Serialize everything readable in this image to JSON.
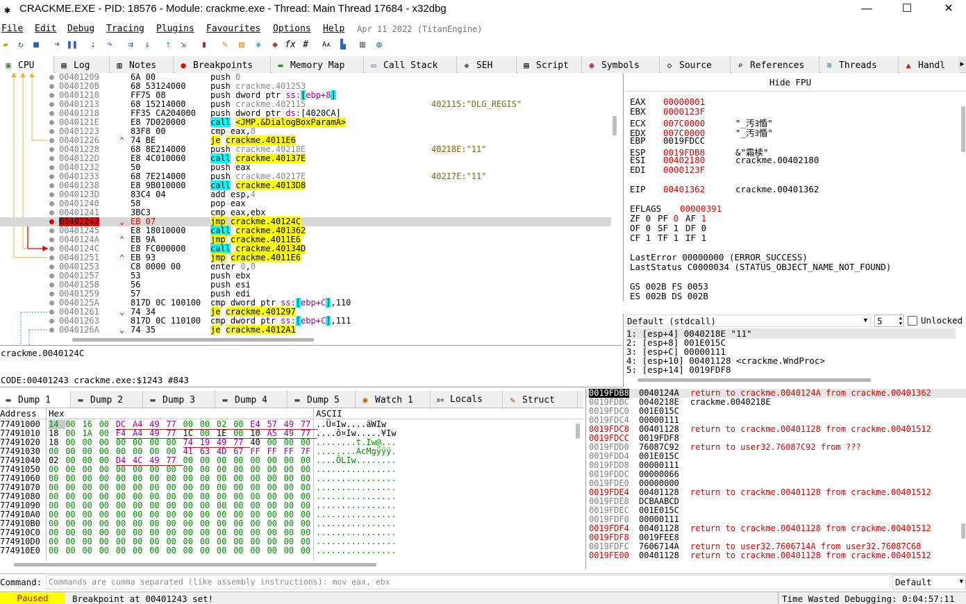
{
  "window": {
    "title": "CRACKME.EXE - PID: 18576 - Module: crackme.exe - Thread: Main Thread 17684 - x32dbg",
    "minimize": "—",
    "maximize": "☐",
    "close": "✕"
  },
  "menu": {
    "items": [
      "File",
      "Edit",
      "Debug",
      "Tracing",
      "Plugins",
      "Favourites",
      "Options",
      "Help"
    ],
    "date": "Apr 11 2022 (TitanEngine)"
  },
  "top_tabs": [
    {
      "label": "CPU",
      "icon": "cpu-icon",
      "glyph": "▣"
    },
    {
      "label": "Log",
      "icon": "log-icon",
      "glyph": "▤"
    },
    {
      "label": "Notes",
      "icon": "notes-icon",
      "glyph": "▥"
    },
    {
      "label": "Breakpoints",
      "icon": "breakpoint-icon",
      "glyph": "●"
    },
    {
      "label": "Memory Map",
      "icon": "memory-map-icon",
      "glyph": "▬"
    },
    {
      "label": "Call Stack",
      "icon": "call-stack-icon",
      "glyph": "▭"
    },
    {
      "label": "SEH",
      "icon": "seh-icon",
      "glyph": "◆"
    },
    {
      "label": "Script",
      "icon": "script-icon",
      "glyph": "▤"
    },
    {
      "label": "Symbols",
      "icon": "symbols-icon",
      "glyph": "◉"
    },
    {
      "label": "Source",
      "icon": "source-icon",
      "glyph": "◇"
    },
    {
      "label": "References",
      "icon": "references-icon",
      "glyph": "⌕"
    },
    {
      "label": "Threads",
      "icon": "threads-icon",
      "glyph": "≋"
    },
    {
      "label": "Handl",
      "icon": "handles-icon",
      "glyph": "▲"
    }
  ],
  "disasm": [
    {
      "addr": "00401209",
      "bytes": "6A 00",
      "ins": [
        [
          "push ",
          ""
        ],
        [
          "0",
          "c-gray"
        ]
      ],
      "comment": ""
    },
    {
      "addr": "0040120B",
      "bytes": "68 53124000",
      "bu": "53124000",
      "ins": [
        [
          "push ",
          ""
        ],
        [
          "crackme.401253",
          "c-gray"
        ]
      ],
      "comment": ""
    },
    {
      "addr": "00401210",
      "bytes": "FF75 08",
      "ins": [
        [
          "push dword ptr ",
          ""
        ],
        [
          "ss:",
          "c-mag"
        ],
        [
          "[",
          "hl-c"
        ],
        [
          "ebp+8",
          "c-mag"
        ],
        [
          "]",
          "hl-c"
        ]
      ],
      "comment": ""
    },
    {
      "addr": "00401213",
      "bytes": "68 15214000",
      "bu": "15214000",
      "ins": [
        [
          "push ",
          ""
        ],
        [
          "crackme.402115",
          "c-gray"
        ]
      ],
      "comment": "402115:\"DLG_REGIS\""
    },
    {
      "addr": "00401218",
      "bytes": "FF35 CA204000",
      "bu": "CA204000",
      "ins": [
        [
          "push dword ptr ",
          ""
        ],
        [
          "ds:",
          "c-mag"
        ],
        [
          "[4020CA]",
          ""
        ]
      ],
      "comment": ""
    },
    {
      "addr": "0040121E",
      "bytes": "E8 7D020000",
      "ins": [
        [
          "call",
          "hl-c"
        ],
        [
          " ",
          ""
        ],
        [
          "<JMP.&DialogBoxParamA>",
          "hl-y"
        ]
      ],
      "comment": ""
    },
    {
      "addr": "00401223",
      "bytes": "83F8 00",
      "ins": [
        [
          "cmp eax,",
          ""
        ],
        [
          "0",
          "c-gray"
        ]
      ],
      "comment": ""
    },
    {
      "addr": "00401226",
      "bytes": "74 BE",
      "mk": "^",
      "ins": [
        [
          "je",
          "hl-y"
        ],
        [
          " ",
          ""
        ],
        [
          "crackme.4011E6",
          "hl-y"
        ]
      ],
      "comment": ""
    },
    {
      "addr": "00401228",
      "bytes": "68 8E214000",
      "bu": "8E214000",
      "ins": [
        [
          "push ",
          ""
        ],
        [
          "crackme.40218E",
          "c-gray"
        ]
      ],
      "comment": "40218E:\"11\""
    },
    {
      "addr": "0040122D",
      "bytes": "E8 4C010000",
      "ins": [
        [
          "call",
          "hl-c"
        ],
        [
          " ",
          ""
        ],
        [
          "crackme.40137E",
          "hl-y"
        ]
      ],
      "comment": ""
    },
    {
      "addr": "00401232",
      "bytes": "50",
      "ins": [
        [
          "push eax",
          ""
        ]
      ],
      "comment": ""
    },
    {
      "addr": "00401233",
      "bytes": "68 7E214000",
      "bu": "7E214000",
      "ins": [
        [
          "push ",
          ""
        ],
        [
          "crackme.40217E",
          "c-gray"
        ]
      ],
      "comment": "40217E:\"11\""
    },
    {
      "addr": "00401238",
      "bytes": "E8 9B010000",
      "ins": [
        [
          "call",
          "hl-c"
        ],
        [
          " ",
          ""
        ],
        [
          "crackme.4013D8",
          "hl-y"
        ]
      ],
      "comment": ""
    },
    {
      "addr": "0040123D",
      "bytes": "83C4 04",
      "ins": [
        [
          "add esp,",
          ""
        ],
        [
          "4",
          "c-gray"
        ]
      ],
      "comment": ""
    },
    {
      "addr": "00401240",
      "bytes": "58",
      "ins": [
        [
          "pop eax",
          ""
        ]
      ],
      "comment": ""
    },
    {
      "addr": "00401241",
      "bytes": "3BC3",
      "ins": [
        [
          "cmp eax,ebx",
          ""
        ]
      ],
      "comment": ""
    },
    {
      "addr": "00401243",
      "bytes": "EB 07",
      "mk": "v",
      "sel": true,
      "bp": true,
      "ins": [
        [
          "jmp",
          "hl-y"
        ],
        [
          " ",
          ""
        ],
        [
          "crackme.40124C",
          "hl-y"
        ]
      ],
      "comment": ""
    },
    {
      "addr": "00401245",
      "bytes": "E8 18010000",
      "ins": [
        [
          "call",
          "hl-c"
        ],
        [
          " ",
          ""
        ],
        [
          "crackme.401362",
          "hl-y"
        ]
      ],
      "comment": ""
    },
    {
      "addr": "0040124A",
      "bytes": "EB 9A",
      "mk": "^",
      "ins": [
        [
          "jmp",
          "hl-y"
        ],
        [
          " ",
          ""
        ],
        [
          "crackme.4011E6",
          "hl-y"
        ]
      ],
      "comment": ""
    },
    {
      "addr": "0040124C",
      "bytes": "E8 FC000000",
      "ins": [
        [
          "call",
          "hl-c"
        ],
        [
          " ",
          ""
        ],
        [
          "crackme.40134D",
          "hl-y"
        ]
      ],
      "comment": ""
    },
    {
      "addr": "00401251",
      "bytes": "EB 93",
      "mk": "^",
      "ins": [
        [
          "jmp",
          "hl-y"
        ],
        [
          " ",
          ""
        ],
        [
          "crackme.4011E6",
          "hl-y"
        ]
      ],
      "comment": ""
    },
    {
      "addr": "00401253",
      "bytes": "C8 0000 00",
      "ins": [
        [
          "enter ",
          ""
        ],
        [
          "0",
          "c-gray"
        ],
        [
          ",",
          ""
        ],
        [
          "0",
          "c-gray"
        ]
      ],
      "comment": ""
    },
    {
      "addr": "00401257",
      "bytes": "53",
      "ins": [
        [
          "push ebx",
          ""
        ]
      ],
      "comment": ""
    },
    {
      "addr": "00401258",
      "bytes": "56",
      "ins": [
        [
          "push esi",
          ""
        ]
      ],
      "comment": ""
    },
    {
      "addr": "00401259",
      "bytes": "57",
      "ins": [
        [
          "push edi",
          ""
        ]
      ],
      "comment": ""
    },
    {
      "addr": "0040125A",
      "bytes": "817D 0C 100100",
      "ins": [
        [
          "cmp dword ptr ",
          ""
        ],
        [
          "ss:",
          "c-mag"
        ],
        [
          "[",
          "hl-c"
        ],
        [
          "ebp+C",
          "c-mag"
        ],
        [
          "]",
          "hl-c"
        ],
        [
          ",110",
          ""
        ]
      ],
      "comment": ""
    },
    {
      "addr": "00401261",
      "bytes": "74 34",
      "mk": "v",
      "ins": [
        [
          "je",
          "hl-y"
        ],
        [
          " ",
          ""
        ],
        [
          "crackme.401297",
          "hl-y"
        ]
      ],
      "comment": ""
    },
    {
      "addr": "00401263",
      "bytes": "817D 0C 110100",
      "ins": [
        [
          "cmp dword ptr ",
          ""
        ],
        [
          "ss:",
          "c-mag"
        ],
        [
          "[",
          "hl-c"
        ],
        [
          "ebp+C",
          "c-mag"
        ],
        [
          "]",
          "hl-c"
        ],
        [
          ",111",
          ""
        ]
      ],
      "comment": ""
    },
    {
      "addr": "0040126A",
      "bytes": "74 35",
      "mk": "v",
      "ins": [
        [
          "je",
          "hl-y"
        ],
        [
          " ",
          ""
        ],
        [
          "crackme.4012A1",
          "hl-y"
        ]
      ],
      "comment": ""
    }
  ],
  "info_panel": {
    "line1": "crackme.0040124C",
    "line2": "CODE:00401243 crackme.exe:$1243 #843"
  },
  "registers": {
    "hide_fpu": "Hide FPU",
    "gp": [
      {
        "name": "EAX",
        "value": "00000001",
        "changed": true,
        "desc": ""
      },
      {
        "name": "EBX",
        "value": "0000123F",
        "changed": true,
        "desc": ""
      },
      {
        "name": "ECX",
        "value": "007C0000",
        "changed": true,
        "desc": "\"_汚ﾖ惛\""
      },
      {
        "name": "EDX",
        "value": "007C0000",
        "changed": true,
        "desc": "\"_汚ﾖ惛\""
      },
      {
        "name": "EBP",
        "value": "0019FDCC",
        "changed": false,
        "desc": ""
      },
      {
        "name": "ESP",
        "value": "0019FDB8",
        "changed": true,
        "desc": "&\"霜椟\""
      },
      {
        "name": "ESI",
        "value": "00402180",
        "changed": true,
        "desc": "crackme.00402180"
      },
      {
        "name": "EDI",
        "value": "0000123F",
        "changed": true,
        "desc": ""
      }
    ],
    "eip": {
      "name": "EIP",
      "value": "00401362",
      "desc": "crackme.00401362"
    },
    "eflags": {
      "name": "EFLAGS",
      "value": "00000391"
    },
    "flags": [
      [
        "ZF",
        "0",
        false
      ],
      [
        "PF",
        "0",
        true
      ],
      [
        "AF",
        "1",
        true
      ],
      [
        "OF",
        "0",
        false
      ],
      [
        "SF",
        "1",
        false
      ],
      [
        "DF",
        "0",
        false
      ],
      [
        "CF",
        "1",
        false
      ],
      [
        "TF",
        "1",
        false
      ],
      [
        "IF",
        "1",
        false
      ]
    ],
    "lasterror": "LastError  00000000 (ERROR_SUCCESS)",
    "laststatus": "LastStatus C0000034 (STATUS_OBJECT_NAME_NOT_FOUND)",
    "seg1": "GS 002B  FS 0053",
    "seg2": "ES 002B  DS 002B"
  },
  "callconv": {
    "convention": "Default (stdcall)",
    "count": "5",
    "unlocked": "Unlocked",
    "args": [
      "1: [esp+4]  0040218E \"11\"",
      "2: [esp+8]  001E015C",
      "3: [esp+C]  00000111",
      "4: [esp+10] 00401128 <crackme.WndProc>",
      "5: [esp+14] 0019FDF8"
    ]
  },
  "dump_tabs": [
    {
      "label": "Dump 1",
      "icon": "dump-icon",
      "glyph": "▬"
    },
    {
      "label": "Dump 2",
      "icon": "dump-icon",
      "glyph": "▬"
    },
    {
      "label": "Dump 3",
      "icon": "dump-icon",
      "glyph": "▬"
    },
    {
      "label": "Dump 4",
      "icon": "dump-icon",
      "glyph": "▬"
    },
    {
      "label": "Dump 5",
      "icon": "dump-icon",
      "glyph": "▬"
    },
    {
      "label": "Watch 1",
      "icon": "watch-icon",
      "glyph": "◉"
    },
    {
      "label": "Locals",
      "icon": "locals-icon",
      "glyph": "x="
    },
    {
      "label": "Struct",
      "icon": "struct-icon",
      "glyph": "✎"
    }
  ],
  "dump": {
    "headers": {
      "address": "Address",
      "hex": "Hex",
      "ascii": "ASCII"
    },
    "rows": [
      {
        "addr": "77491000",
        "hex": "14 00 16 00 DC A4 49 77 00 00 02 00 E4 57 49 77",
        "ascii": "..Ü¤Iw....äWIw"
      },
      {
        "addr": "77491010",
        "hex": "18 00 1A 00 F4 A4 49 77 1C 00 1E 00 10 A5 49 77",
        "ascii": "....ô¤Iw.....¥Iw"
      },
      {
        "addr": "77491020",
        "hex": "18 00 00 00 00 00 00 00 74 19 49 77 40 00 00 00",
        "ascii": "........t.Iw@..."
      },
      {
        "addr": "77491030",
        "hex": "00 00 00 00 00 00 00 00 41 63 4D 67 FF FF FF 7F",
        "ascii": "........AcMgÿÿÿ."
      },
      {
        "addr": "77491040",
        "hex": "02 00 00 00 D4 4C 49 77 00 00 00 00 00 00 00 00",
        "ascii": "....ÔLIw........"
      },
      {
        "addr": "77491050",
        "hex": "00 00 00 00 00 00 00 00 00 00 00 00 00 00 00 00",
        "ascii": "................"
      },
      {
        "addr": "77491060",
        "hex": "00 00 00 00 00 00 00 00 00 00 00 00 00 00 00 00",
        "ascii": "................"
      },
      {
        "addr": "77491070",
        "hex": "00 00 00 00 00 00 00 00 00 00 00 00 00 00 00 00",
        "ascii": "................"
      },
      {
        "addr": "77491080",
        "hex": "00 00 00 00 00 00 00 00 00 00 00 00 00 00 00 00",
        "ascii": "................"
      },
      {
        "addr": "77491090",
        "hex": "00 00 00 00 00 00 00 00 00 00 00 00 00 00 00 00",
        "ascii": "................"
      },
      {
        "addr": "774910A0",
        "hex": "00 00 00 00 00 00 00 00 00 00 00 00 00 00 00 00",
        "ascii": "................"
      },
      {
        "addr": "774910B0",
        "hex": "00 00 00 00 00 00 00 00 00 00 00 00 00 00 00 00",
        "ascii": "................"
      },
      {
        "addr": "774910C0",
        "hex": "00 00 00 00 00 00 00 00 00 00 00 00 00 00 00 00",
        "ascii": "................"
      },
      {
        "addr": "774910D0",
        "hex": "00 00 00 00 00 00 00 00 00 00 00 00 00 00 00 00",
        "ascii": "................"
      },
      {
        "addr": "774910E0",
        "hex": "00 00 00 00 00 00 00 00 00 00 00 00 00 00 00 00",
        "ascii": "................"
      }
    ]
  },
  "stack": [
    {
      "addr": "0019FDB8",
      "val": "0040124A",
      "comment": "return to crackme.0040124A from crackme.00401362",
      "sel": true,
      "red": true
    },
    {
      "addr": "0019FDBC",
      "val": "0040218E",
      "comment": "crackme.0040218E",
      "red": false,
      "black": true
    },
    {
      "addr": "0019FDC0",
      "val": "001E015C",
      "comment": ""
    },
    {
      "addr": "0019FDC4",
      "val": "00000111",
      "comment": ""
    },
    {
      "addr": "0019FDC8",
      "val": "00401128",
      "comment": "return to crackme.00401128 from crackme.00401512",
      "red": true
    },
    {
      "addr": "0019FDCC",
      "val": "0019FDF8",
      "comment": "",
      "red": true
    },
    {
      "addr": "0019FDD0",
      "val": "76087C92",
      "comment": "return to user32.76087C92 from ???"
    },
    {
      "addr": "0019FDD4",
      "val": "001E015C",
      "comment": ""
    },
    {
      "addr": "0019FDD8",
      "val": "00000111",
      "comment": ""
    },
    {
      "addr": "0019FDDC",
      "val": "00000066",
      "comment": ""
    },
    {
      "addr": "0019FDE0",
      "val": "00000000",
      "comment": ""
    },
    {
      "addr": "0019FDE4",
      "val": "00401128",
      "comment": "return to crackme.00401128 from crackme.00401512",
      "red": true
    },
    {
      "addr": "0019FDE8",
      "val": "DCBAABCD",
      "comment": ""
    },
    {
      "addr": "0019FDEC",
      "val": "001E015C",
      "comment": ""
    },
    {
      "addr": "0019FDF0",
      "val": "00000111",
      "comment": ""
    },
    {
      "addr": "0019FDF4",
      "val": "00401128",
      "comment": "return to crackme.00401128 from crackme.00401512",
      "red": true
    },
    {
      "addr": "0019FDF8",
      "val": "0019FEE8",
      "comment": "",
      "red": true
    },
    {
      "addr": "0019FDFC",
      "val": "7606714A",
      "comment": "return to user32.7606714A from user32.76087C68"
    },
    {
      "addr": "0019FE00",
      "val": "00401128",
      "comment": "return to crackme.00401128 from crackme.00401512",
      "red": true
    }
  ],
  "command": {
    "label": "Command:",
    "placeholder": "Commands are comma separated (like assembly instructions): mov eax, ebx",
    "mode": "Default"
  },
  "status": {
    "state": "Paused",
    "message": "Breakpoint at 00401243 set!",
    "time": "Time Wasted Debugging: 0:04:57:11"
  },
  "colors": {
    "paused": "#ffff00",
    "addr_red": "#ff0000",
    "highlight_yellow": "#ffff00",
    "highlight_cyan": "#00ffff"
  }
}
